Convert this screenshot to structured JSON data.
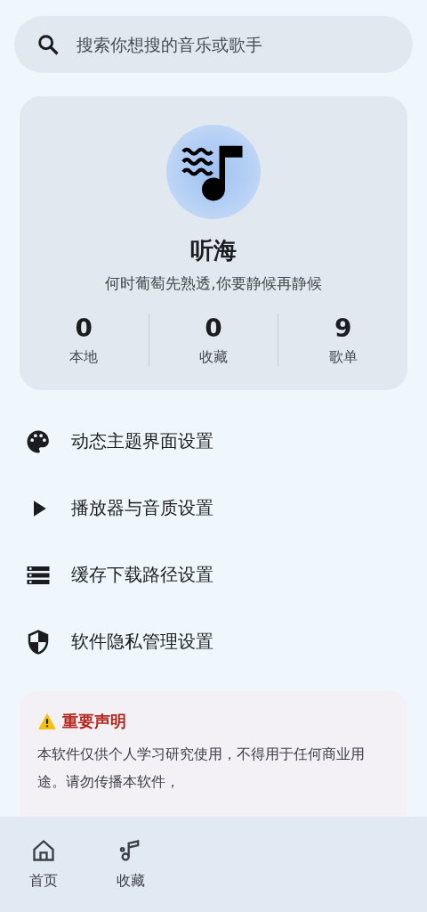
{
  "search": {
    "placeholder": "搜索你想搜的音乐或歌手"
  },
  "profile": {
    "name": "听海",
    "motto": "何时葡萄先熟透,你要静候再静候",
    "stats": [
      {
        "value": "0",
        "label": "本地"
      },
      {
        "value": "0",
        "label": "收藏"
      },
      {
        "value": "9",
        "label": "歌单"
      }
    ]
  },
  "settings": [
    {
      "kind": "palette",
      "label": "动态主题界面设置"
    },
    {
      "kind": "play",
      "label": "播放器与音质设置"
    },
    {
      "kind": "storage",
      "label": "缓存下载路径设置"
    },
    {
      "kind": "shield",
      "label": "软件隐私管理设置"
    }
  ],
  "notice": {
    "title": "重要声明",
    "lines": [
      "本软件仅供个人学习研究使用，不得用于任何商业用",
      "途。请勿传播本软件，"
    ]
  },
  "nav": [
    {
      "kind": "home",
      "label": "首页",
      "selected": false
    },
    {
      "kind": "music",
      "label": "收藏",
      "selected": false
    }
  ]
}
